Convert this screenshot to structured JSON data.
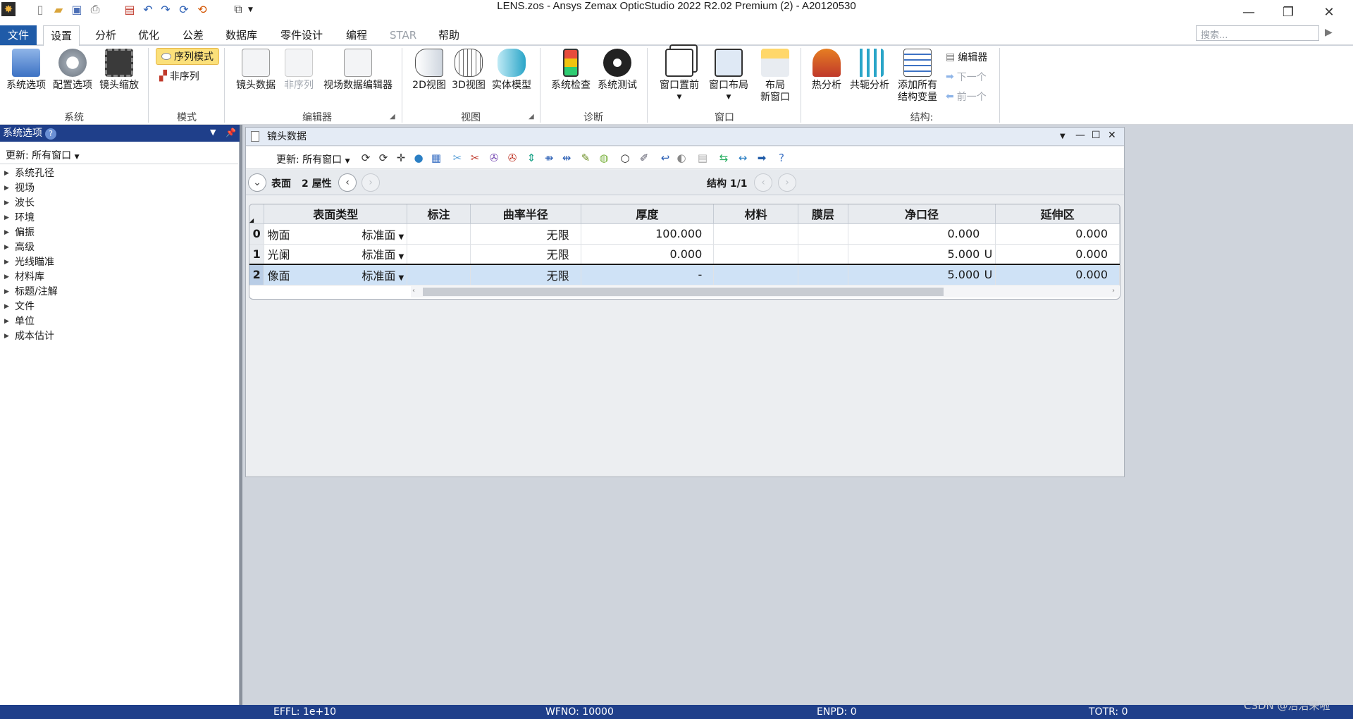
{
  "title": "LENS.zos - Ansys Zemax OpticStudio 2022 R2.02   Premium (2) - A20120530",
  "menu": [
    "文件",
    "设置",
    "分析",
    "优化",
    "公差",
    "数据库",
    "零件设计",
    "编程",
    "STAR",
    "帮助"
  ],
  "search_placeholder": "搜索...",
  "ribbon": {
    "system": {
      "items": [
        "系统选项",
        "配置选项",
        "镜头缩放"
      ],
      "label": "系统"
    },
    "mode": {
      "seq": "序列模式",
      "nonseq": "非序列",
      "label": "模式"
    },
    "editor": {
      "items": [
        "镜头数据",
        "非序列",
        "视场数据编辑器"
      ],
      "label": "编辑器"
    },
    "view": {
      "items": [
        "2D视图",
        "3D视图",
        "实体模型"
      ],
      "label": "视图"
    },
    "diag": {
      "items": [
        "系统检查",
        "系统测试"
      ],
      "label": "诊断"
    },
    "window": {
      "items": [
        "窗口置前",
        "窗口布局",
        "布局",
        "新窗口"
      ],
      "label": "窗口"
    },
    "config": {
      "items": [
        "热分析",
        "共轭分析",
        "添加所有",
        "结构变量"
      ],
      "editor": "编辑器",
      "next": "下一个",
      "prev": "前一个",
      "label": "结构:"
    }
  },
  "left": {
    "title": "系统选项",
    "update": "更新: 所有窗口",
    "tree": [
      "系统孔径",
      "视场",
      "波长",
      "环境",
      "偏振",
      "高级",
      "光线瞄准",
      "材料库",
      "标题/注解",
      "文件",
      "单位",
      "成本估计"
    ]
  },
  "lens": {
    "title": "镜头数据",
    "update": "更新: 所有窗口",
    "surface": "表面",
    "props": "2 屋性",
    "config": "结构 1/1",
    "columns": [
      "表面类型",
      "标注",
      "曲率半径",
      "厚度",
      "材料",
      "膜层",
      "净口径",
      "延伸区"
    ],
    "rows": [
      {
        "n": "0",
        "name": "物面",
        "type": "标准面",
        "radius": "无限",
        "thick": "100.000",
        "clear": "0.000",
        "cflag": "",
        "ext": "0.000"
      },
      {
        "n": "1",
        "name": "光阑",
        "type": "标准面",
        "radius": "无限",
        "thick": "0.000",
        "clear": "5.000",
        "cflag": "U",
        "ext": "0.000"
      },
      {
        "n": "2",
        "name": "像面",
        "type": "标准面",
        "radius": "无限",
        "thick": "-",
        "clear": "5.000",
        "cflag": "U",
        "ext": "0.000"
      }
    ]
  },
  "status": [
    "EFFL: 1e+10",
    "WFNO: 10000",
    "ENPD: 0",
    "TOTR: 0"
  ],
  "watermark": "CSDN @治治来啦"
}
